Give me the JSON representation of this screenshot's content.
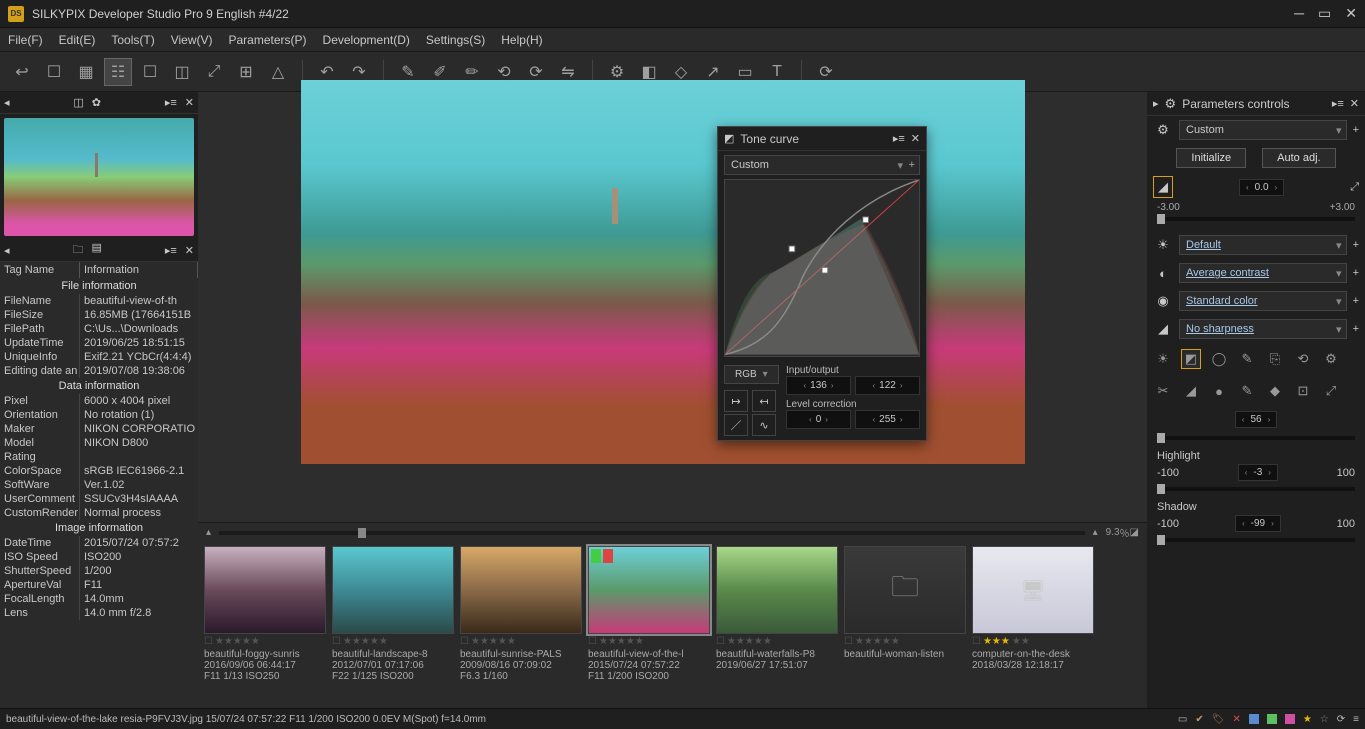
{
  "app": {
    "title": "SILKYPIX Developer Studio Pro 9 English   #4/22"
  },
  "menus": {
    "file": "File(F)",
    "edit": "Edit(E)",
    "tools": "Tools(T)",
    "view": "View(V)",
    "parameters": "Parameters(P)",
    "development": "Development(D)",
    "settings": "Settings(S)",
    "help": "Help(H)"
  },
  "info": {
    "h1": "Tag Name",
    "h2": "Information",
    "s1": "File information",
    "r1k": "FileName",
    "r1v": "beautiful-view-of-th",
    "r2k": "FileSize",
    "r2v": "16.85MB (17664151B",
    "r3k": "FilePath",
    "r3v": "C:\\Us...\\Downloads",
    "r4k": "UpdateTime",
    "r4v": "2019/06/25 18:51:15",
    "r5k": "UniqueInfo",
    "r5v": "Exif2.21 YCbCr(4:4:4)",
    "r6k": "Editing date an",
    "r6v": "2019/07/08 19:38:06",
    "s2": "Data information",
    "r7k": "Pixel",
    "r7v": "6000 x 4004 pixel",
    "r8k": "Orientation",
    "r8v": "No rotation (1)",
    "r9k": "Maker",
    "r9v": "NIKON CORPORATIO",
    "r10k": "Model",
    "r10v": "NIKON D800",
    "r11k": "Rating",
    "r11v": "",
    "r12k": "ColorSpace",
    "r12v": "sRGB IEC61966-2.1",
    "r13k": "SoftWare",
    "r13v": "Ver.1.02",
    "r14k": "UserComment",
    "r14v": "SSUCv3H4sIAAAA",
    "r15k": "CustomRender",
    "r15v": "Normal process",
    "s3": "Image information",
    "r16k": "DateTime",
    "r16v": "2015/07/24 07:57:2",
    "r17k": "ISO Speed",
    "r17v": "ISO200",
    "r18k": "ShutterSpeed",
    "r18v": "1/200",
    "r19k": "ApertureVal",
    "r19v": "F11",
    "r20k": "FocalLength",
    "r20v": "14.0mm",
    "r21k": "Lens",
    "r21v": "14.0 mm f/2.8"
  },
  "zoom": {
    "value": "9.3",
    "unit": "％"
  },
  "thumbs": [
    {
      "name": "beautiful-foggy-sunris",
      "l2": "2016/09/06 06:44:17",
      "l3": "F11 1/13 ISO250"
    },
    {
      "name": "beautiful-landscape-8",
      "l2": "2012/07/01 07:17:06",
      "l3": "F22 1/125 ISO200"
    },
    {
      "name": "beautiful-sunrise-PALS",
      "l2": "2009/08/16 07:09:02",
      "l3": "F6.3 1/160"
    },
    {
      "name": "beautiful-view-of-the-l",
      "l2": "2015/07/24 07:57:22",
      "l3": "F11 1/200 ISO200"
    },
    {
      "name": "beautiful-waterfalls-P8",
      "l2": "2019/06/27 17:51:07",
      "l3": ""
    },
    {
      "name": "beautiful-woman-listen",
      "l2": "",
      "l3": ""
    },
    {
      "name": "computer-on-the-desk",
      "l2": "2018/03/28 12:18:17",
      "l3": ""
    }
  ],
  "tone": {
    "title": "Tone curve",
    "preset": "Custom",
    "channel": "RGB",
    "io_label": "Input/output",
    "io_in": "136",
    "io_out": "122",
    "lc_label": "Level correction",
    "lc_lo": "0",
    "lc_hi": "255"
  },
  "params": {
    "title": "Parameters controls",
    "preset": "Custom",
    "btn_init": "Initialize",
    "btn_auto": "Auto adj.",
    "exp_val": "0.0",
    "exp_min": "-3.00",
    "exp_max": "+3.00",
    "wb": "Default",
    "contrast": "Average contrast",
    "color": "Standard color",
    "sharp": "No sharpness",
    "mid_val": "56",
    "hl_label": "Highlight",
    "hl_min": "-100",
    "hl_val": "-3",
    "hl_max": "100",
    "sh_label": "Shadow",
    "sh_min": "-100",
    "sh_val": "-99",
    "sh_max": "100"
  },
  "status": {
    "text": "beautiful-view-of-the-lake resia-P9FVJ3V.jpg 15/07/24 07:57:22 F11 1/200 ISO200  0.0EV M(Spot) f=14.0mm"
  }
}
